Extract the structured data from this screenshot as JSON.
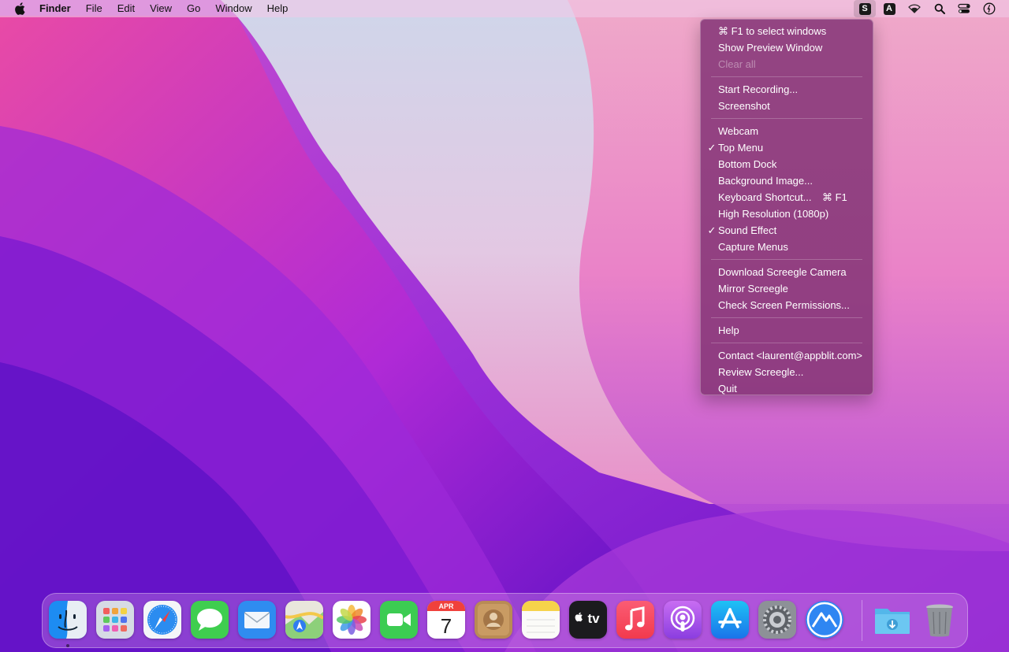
{
  "menubar": {
    "app_name": "Finder",
    "items": [
      "File",
      "Edit",
      "View",
      "Go",
      "Window",
      "Help"
    ],
    "status_icons": [
      {
        "icon": "screegle-icon",
        "letter": "S",
        "active": true
      },
      {
        "icon": "text-input-icon",
        "letter": "A"
      },
      {
        "icon": "wifi-icon"
      },
      {
        "icon": "spotlight-search-icon"
      },
      {
        "icon": "control-center-icon"
      },
      {
        "icon": "siri-icon"
      }
    ]
  },
  "menu": {
    "groups": [
      [
        {
          "label": "⌘ F1 to select windows"
        },
        {
          "label": "Show Preview Window"
        },
        {
          "label": "Clear all",
          "disabled": true
        }
      ],
      [
        {
          "label": "Start Recording..."
        },
        {
          "label": "Screenshot"
        }
      ],
      [
        {
          "label": "Webcam"
        },
        {
          "label": "Top Menu",
          "checked": true
        },
        {
          "label": "Bottom Dock"
        },
        {
          "label": "Background Image..."
        },
        {
          "label": "Keyboard Shortcut...",
          "shortcut": "⌘ F1"
        },
        {
          "label": "High Resolution (1080p)"
        },
        {
          "label": "Sound Effect",
          "checked": true
        },
        {
          "label": "Capture Menus"
        }
      ],
      [
        {
          "label": "Download Screegle Camera"
        },
        {
          "label": "Mirror Screegle"
        },
        {
          "label": "Check Screen Permissions..."
        }
      ],
      [
        {
          "label": "Help"
        }
      ],
      [
        {
          "label": "Contact <laurent@appblit.com>"
        },
        {
          "label": "Review Screegle..."
        },
        {
          "label": "Quit"
        }
      ]
    ]
  },
  "dock": {
    "apps": [
      {
        "name": "finder-icon",
        "running": true
      },
      {
        "name": "launchpad-icon"
      },
      {
        "name": "safari-icon"
      },
      {
        "name": "messages-icon"
      },
      {
        "name": "mail-icon"
      },
      {
        "name": "maps-icon"
      },
      {
        "name": "photos-icon"
      },
      {
        "name": "facetime-icon"
      },
      {
        "name": "calendar-icon",
        "month": "APR",
        "day": "7"
      },
      {
        "name": "contacts-icon"
      },
      {
        "name": "notes-icon"
      },
      {
        "name": "apple-tv-icon",
        "label": "tv"
      },
      {
        "name": "music-icon"
      },
      {
        "name": "podcasts-icon"
      },
      {
        "name": "app-store-icon"
      },
      {
        "name": "system-preferences-icon"
      },
      {
        "name": "screegle-app-icon"
      }
    ],
    "extras": [
      {
        "name": "downloads-folder-icon"
      },
      {
        "name": "trash-icon"
      }
    ]
  },
  "colors": {
    "menu_bg": "#843476",
    "wallpaper_light": "#d7cde8",
    "wallpaper_pink": "#e040b8",
    "wallpaper_purple": "#6a12c8"
  }
}
